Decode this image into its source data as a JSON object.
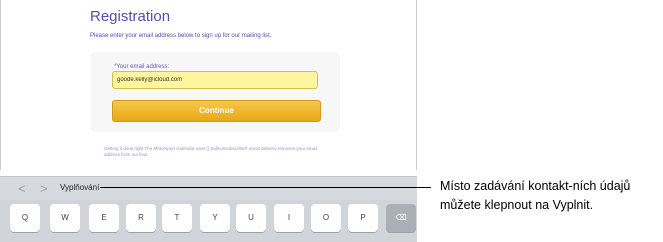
{
  "form": {
    "title": "Registration",
    "subtitle": "Please enter your email address below to sign up for our mailing list.",
    "email_label": "*Your email address:",
    "email_value": "goode.kelly@icloud.com",
    "continue_label": "Continue",
    "footer_note": "Getting it done right The Motorsport Calendar uses [] SafeUnsubscribe® email delivery removes your email address from our lists."
  },
  "accessory_bar": {
    "prev_icon": "chevron-left-icon",
    "next_icon": "chevron-right-icon",
    "prev_glyph": "<",
    "next_glyph": ">",
    "autofill_label": "Vyplňování"
  },
  "keyboard": {
    "keys": [
      "Q",
      "W",
      "E",
      "R",
      "T",
      "Y",
      "U",
      "I",
      "O",
      "P"
    ],
    "backspace_icon": "backspace-icon",
    "backspace_glyph": "⌫"
  },
  "callout": {
    "text": "Místo zadávání kontakt-ních údajů můžete klepnout na Vyplnit."
  },
  "colors": {
    "accent": "#5a4ab0",
    "button": "#e8a917",
    "input_fill": "#fff59e",
    "keyboard_bg": "#d1d4d9"
  }
}
